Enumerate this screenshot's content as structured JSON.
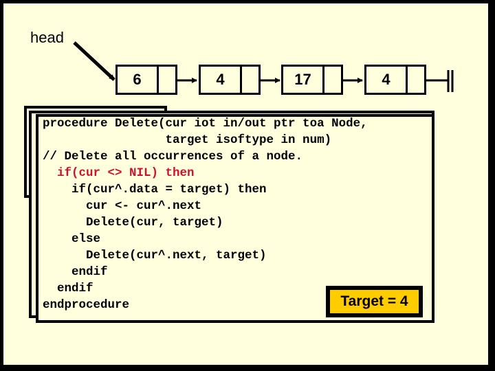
{
  "diagram": {
    "head_label": "head",
    "nodes": [
      {
        "value": "6"
      },
      {
        "value": "4"
      },
      {
        "value": "17"
      },
      {
        "value": "4"
      }
    ],
    "terminator": "nil-ground"
  },
  "code": {
    "lines": [
      {
        "text": "procedure Delete(cur iot in/out ptr toa Node,",
        "color": "black"
      },
      {
        "text": "                 target isoftype in num)",
        "color": "black"
      },
      {
        "text": "// Delete all occurrences of a node.",
        "color": "black"
      },
      {
        "text": "  if(cur <> NIL) then",
        "color": "red"
      },
      {
        "text": "    if(cur^.data = target) then",
        "color": "black"
      },
      {
        "text": "      cur <- cur^.next",
        "color": "black"
      },
      {
        "text": "      Delete(cur, target)",
        "color": "black"
      },
      {
        "text": "    else",
        "color": "black"
      },
      {
        "text": "      Delete(cur^.next, target)",
        "color": "black"
      },
      {
        "text": "    endif",
        "color": "black"
      },
      {
        "text": "  endif",
        "color": "black"
      },
      {
        "text": "endprocedure",
        "color": "black"
      }
    ]
  },
  "target_label": "Target = 4",
  "colors": {
    "background": "#ffffdd",
    "highlight": "#ffcc00",
    "keyword_red": "#cc1133"
  }
}
